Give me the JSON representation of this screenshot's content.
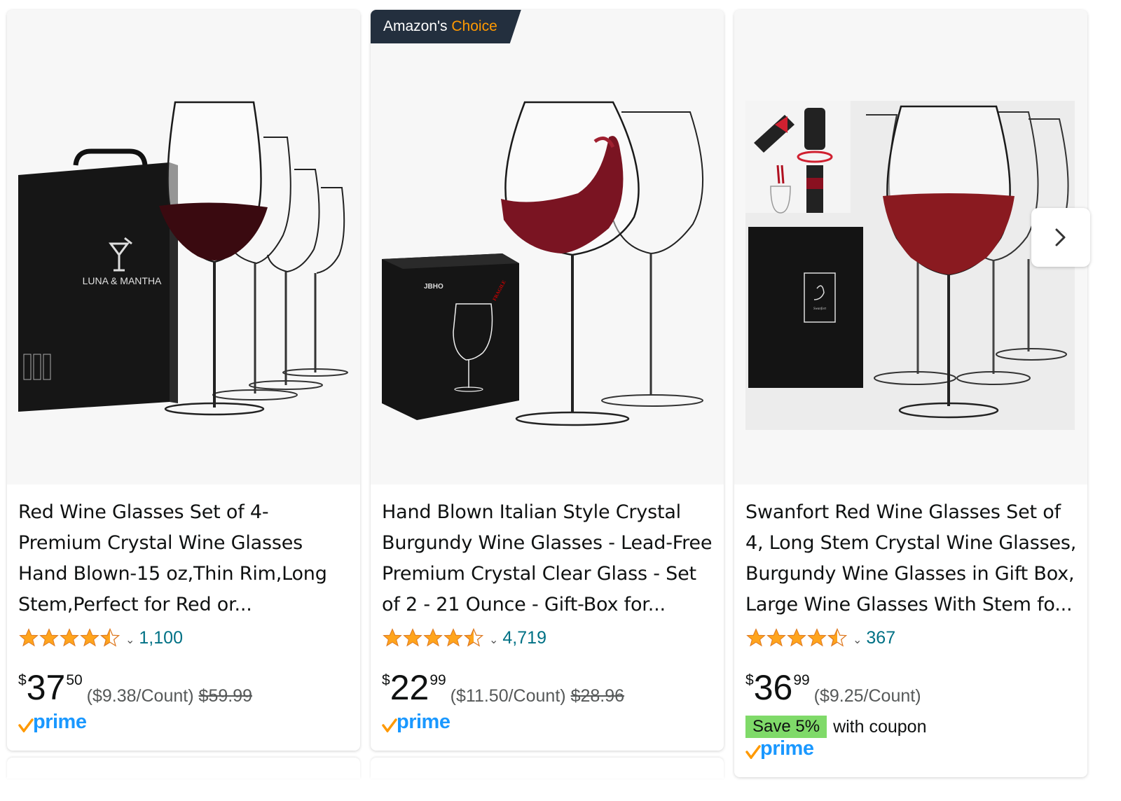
{
  "carousel": {
    "next_icon": "chevron-right-icon"
  },
  "products": [
    {
      "badge": null,
      "box_brand": "LUNA & MANTHA",
      "title": "Red Wine Glasses Set of 4-Premium Crystal Wine Glasses Hand Blown-15 oz,Thin Rim,Long Stem,Perfect for Red or...",
      "rating": 4.5,
      "review_count": "1,100",
      "price_symbol": "$",
      "price_whole": "37",
      "price_fraction": "50",
      "unit_price": "($9.38/Count)",
      "list_price": "$59.99",
      "coupon_badge": null,
      "coupon_text": null,
      "prime": "prime"
    },
    {
      "badge": {
        "text": "Amazon's",
        "highlight": "Choice"
      },
      "box_brand": "JBHO",
      "box_sticker": "FRAGILE",
      "title": "Hand Blown Italian Style Crystal Burgundy Wine Glasses - Lead-Free Premium Crystal Clear Glass - Set of 2 - 21 Ounce - Gift-Box for...",
      "rating": 4.5,
      "review_count": "4,719",
      "price_symbol": "$",
      "price_whole": "22",
      "price_fraction": "99",
      "unit_price": "($11.50/Count)",
      "list_price": "$28.96",
      "coupon_badge": null,
      "coupon_text": null,
      "prime": "prime"
    },
    {
      "badge": null,
      "box_brand": "Swanfort",
      "title": "Swanfort Red Wine Glasses Set of 4, Long Stem Crystal Wine Glasses, Burgundy Wine Glasses in Gift Box, Large Wine Glasses With Stem fo...",
      "rating": 4.5,
      "review_count": "367",
      "price_symbol": "$",
      "price_whole": "36",
      "price_fraction": "99",
      "unit_price": "($9.25/Count)",
      "list_price": null,
      "coupon_badge": "Save 5%",
      "coupon_text": "with coupon",
      "prime": "prime"
    }
  ],
  "colors": {
    "star": "#ffa41c",
    "link": "#007185",
    "prime": "#1a98ff",
    "coupon": "#7fda69",
    "badge_bg": "#232f3e",
    "badge_accent": "#ff9900"
  }
}
